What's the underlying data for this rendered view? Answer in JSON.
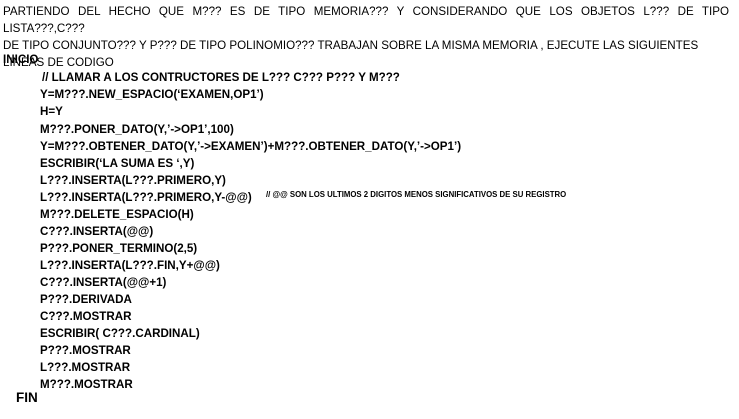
{
  "intro": {
    "line1": "PARTIENDO DEL HECHO QUE M??? ES DE TIPO MEMORIA??? Y CONSIDERANDO QUE  LOS OBJETOS L??? DE TIPO LISTA???,C???",
    "line2": "DE TIPO CONJUNTO??? Y P??? DE TIPO POLINOMIO??? TRABAJAN SOBRE LA MISMA MEMORIA , EJECUTE LAS SIGUIENTES",
    "line3": "LINEAS DE CODIGO"
  },
  "inicio": "INICIO",
  "code": {
    "comment": "// LLAMAR A LOS CONTRUCTORES DE L??? C??? P??? Y M???",
    "lines": [
      "Y=M???.NEW_ESPACIO(‘EXAMEN,OP1’)",
      "H=Y",
      "M???.PONER_DATO(Y,’->OP1’,100)",
      "Y=M???.OBTENER_DATO(Y,’->EXAMEN’)+M???.OBTENER_DATO(Y,’->OP1’)",
      "ESCRIBIR(‘LA SUMA ES ‘,Y)",
      "L???.INSERTA(L???.PRIMERO,Y)",
      "L???.INSERTA(L???.PRIMERO,Y-@@)",
      "M???.DELETE_ESPACIO(H)",
      "C???.INSERTA(@@)",
      "P???.PONER_TERMINO(2,5)",
      "L???.INSERTA(L???.FIN,Y+@@)",
      "C???.INSERTA(@@+1)",
      "P???.DERIVADA",
      "C???.MOSTRAR",
      "ESCRIBIR( C???.CARDINAL)",
      "P???.MOSTRAR",
      "L???.MOSTRAR",
      "M???.MOSTRAR"
    ],
    "side_comment": "// @@ SON LOS ULTIMOS 2 DIGITOS MENOS SIGNIFICATIVOS DE SU REGISTRO"
  },
  "fin": "FIN"
}
